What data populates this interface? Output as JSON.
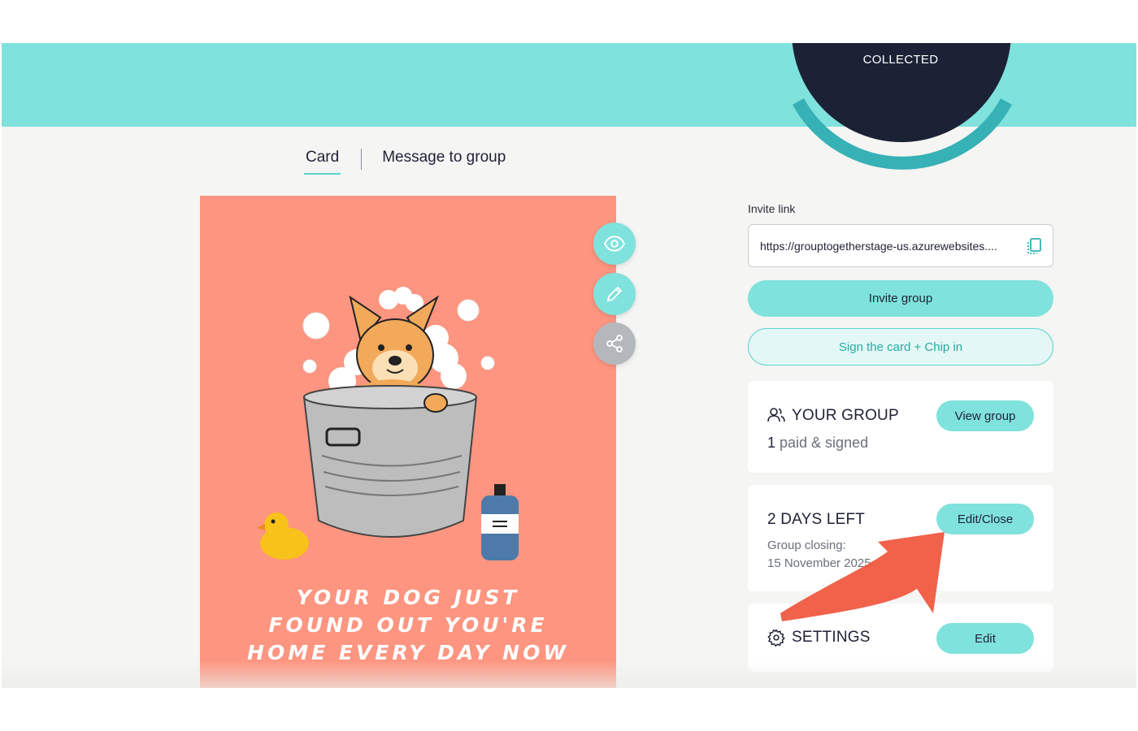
{
  "header": {
    "collected_label": "COLLECTED"
  },
  "tabs": [
    {
      "label": "Card",
      "active": true
    },
    {
      "label": "Message to group",
      "active": false
    }
  ],
  "card": {
    "text_lines": [
      "YOUR DOG JUST",
      "FOUND OUT YOU'RE",
      "HOME EVERY DAY NOW"
    ],
    "background_color": "#fd9580"
  },
  "card_actions": [
    {
      "icon": "eye-icon"
    },
    {
      "icon": "pencil-icon"
    },
    {
      "icon": "share-icon"
    }
  ],
  "invite": {
    "label": "Invite link",
    "link_value": "https://grouptogetherstage-us.azurewebsites....",
    "invite_button": "Invite group",
    "sign_button": "Sign the card + Chip in"
  },
  "group_panel": {
    "title": "YOUR GROUP",
    "paid_count": "1",
    "paid_text": " paid & signed",
    "button": "View group"
  },
  "days_panel": {
    "title": "2 DAYS LEFT",
    "closing_label": "Group closing:",
    "closing_date": "15 November 2025",
    "button": "Edit/Close"
  },
  "settings_panel": {
    "title": "SETTINGS",
    "button": "Edit"
  },
  "colors": {
    "accent": "#80e2dc",
    "dark": "#1c2236",
    "annotation_arrow": "#ef5a40"
  }
}
